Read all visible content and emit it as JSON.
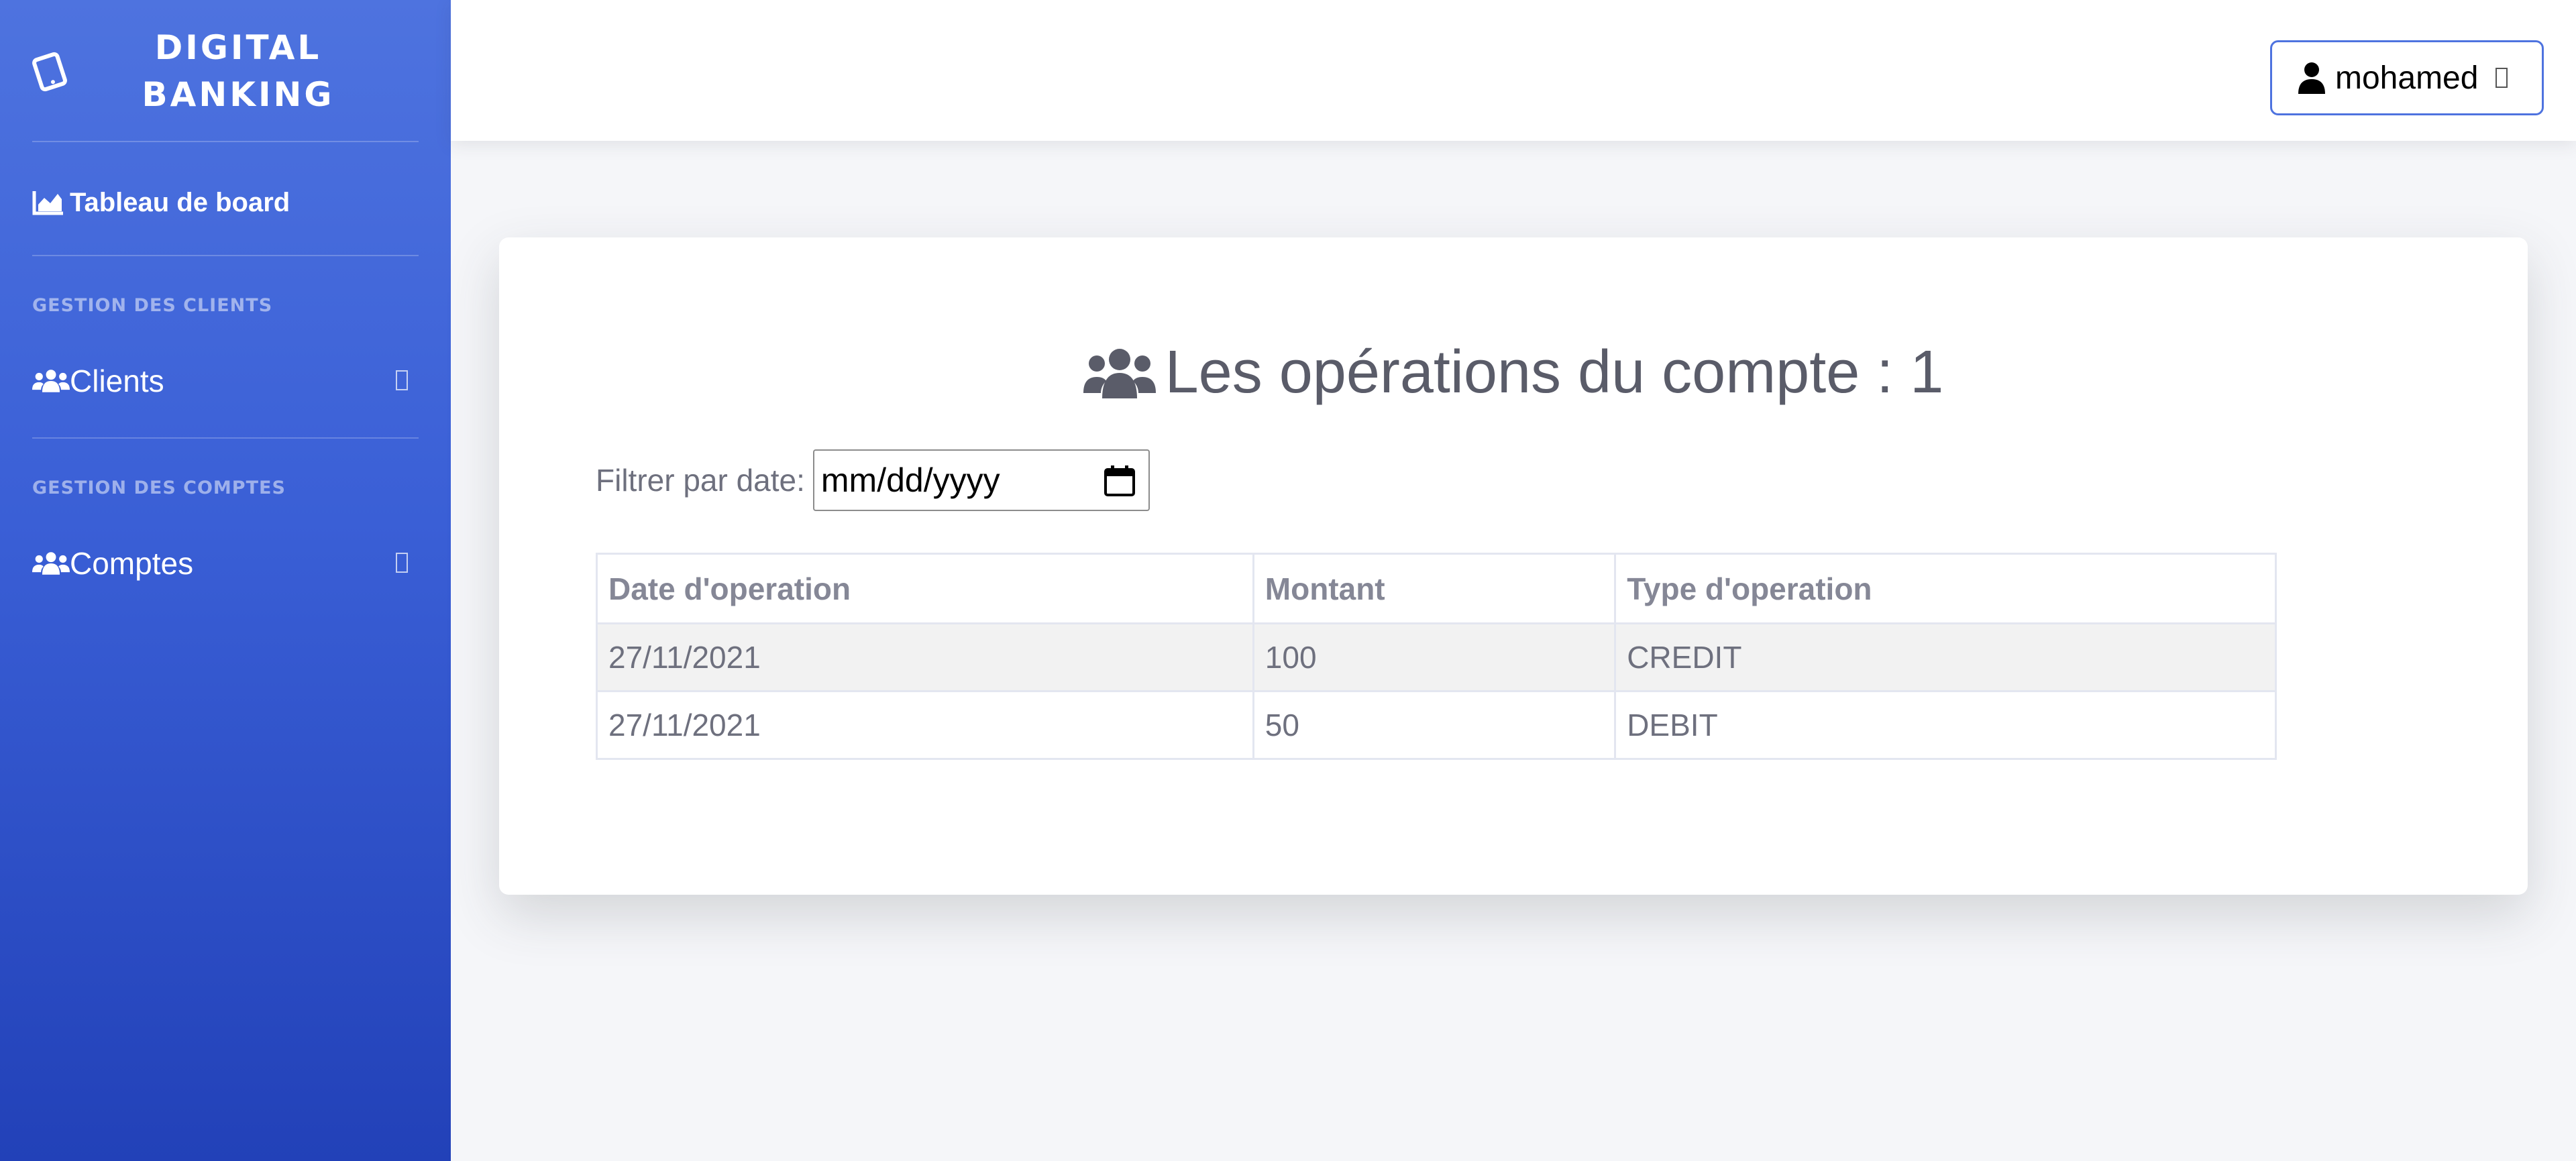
{
  "sidebar": {
    "brand": {
      "line1": "DIGITAL",
      "line2": "BANKING",
      "icon": "tablet-icon"
    },
    "dashboard": {
      "label": "Tableau de board",
      "icon": "chart-area-icon"
    },
    "sections": [
      {
        "heading": "GESTION DES CLIENTS",
        "item": {
          "label": "Clients",
          "icon": "users-icon"
        }
      },
      {
        "heading": "GESTION DES COMPTES",
        "item": {
          "label": "Comptes",
          "icon": "users-icon"
        }
      }
    ]
  },
  "topbar": {
    "user": {
      "name": "mohamed",
      "icon": "user-icon"
    }
  },
  "main": {
    "title": "Les opérations du compte : 1",
    "title_icon": "users-icon",
    "filter": {
      "label": "Filtrer par date:",
      "placeholder": "mm/dd/yyyy",
      "icon": "calendar-icon"
    },
    "table": {
      "headers": [
        "Date d'operation",
        "Montant",
        "Type d'operation"
      ],
      "rows": [
        [
          "27/11/2021",
          "100",
          "CREDIT"
        ],
        [
          "27/11/2021",
          "50",
          "DEBIT"
        ]
      ]
    }
  },
  "colors": {
    "primary": "#4e73df",
    "primary_dark": "#2241b8",
    "text": "#5a5c69",
    "border": "#e3e6f0"
  }
}
